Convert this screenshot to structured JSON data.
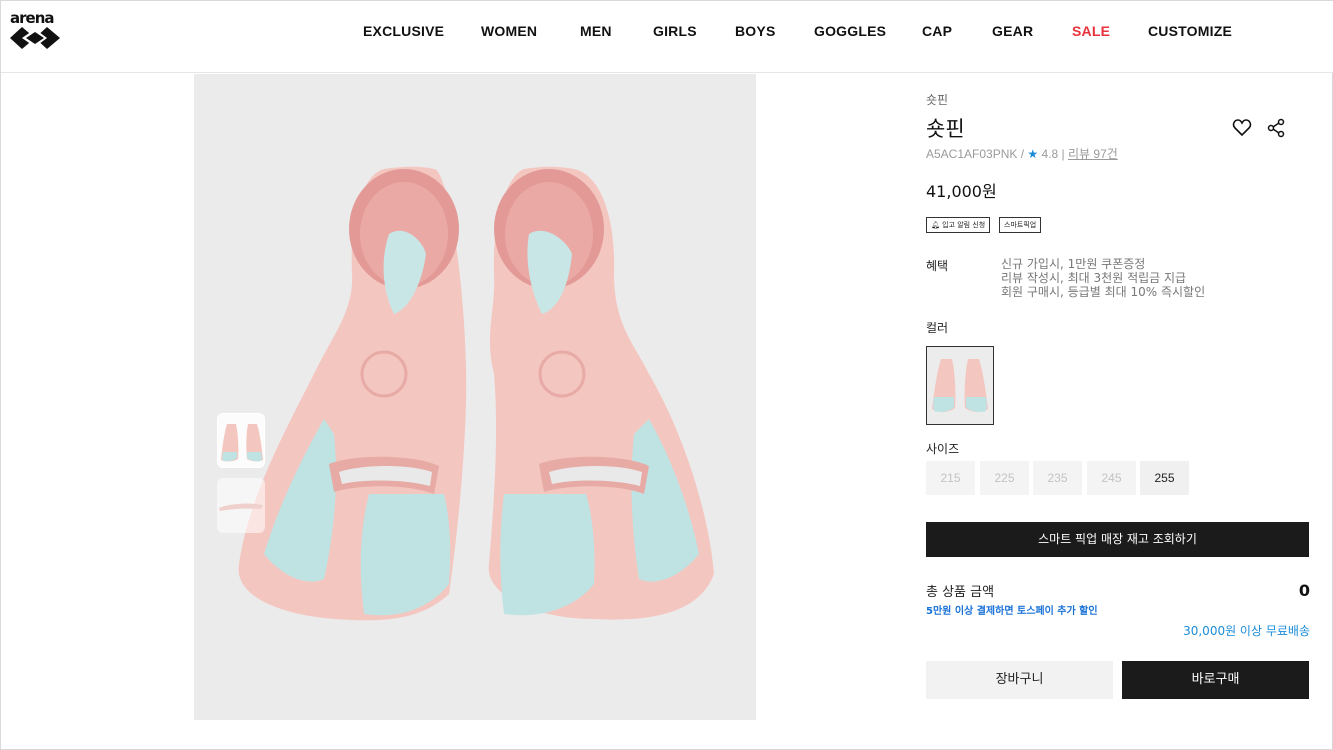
{
  "brand": {
    "logo_text": "arena"
  },
  "nav": {
    "items": [
      {
        "label": "EXCLUSIVE"
      },
      {
        "label": "WOMEN"
      },
      {
        "label": "MEN"
      },
      {
        "label": "GIRLS"
      },
      {
        "label": "BOYS"
      },
      {
        "label": "GOGGLES"
      },
      {
        "label": "CAP"
      },
      {
        "label": "GEAR"
      },
      {
        "label": "SALE"
      },
      {
        "label": "CUSTOMIZE"
      }
    ],
    "sale_color": "#e8323c"
  },
  "product": {
    "category": "숏핀",
    "name": "숏핀",
    "code": "A5AC1AF03PNK",
    "rating": "4.8",
    "review_label": "리뷰 97건",
    "price": "41,000원",
    "chips": [
      "입고 알림 신청",
      "스마트픽업"
    ],
    "benefit_label": "혜택",
    "benefits": [
      "신규 가입시, 1만원 쿠폰증정",
      "리뷰 작성시, 최대 3천원 적립금 지급",
      "회원 구매시, 등급별 최대 10% 즉시할인"
    ],
    "color_label": "컬러",
    "size_label": "사이즈",
    "sizes": [
      {
        "label": "215",
        "available": false
      },
      {
        "label": "225",
        "available": false
      },
      {
        "label": "235",
        "available": false
      },
      {
        "label": "245",
        "available": false
      },
      {
        "label": "255",
        "available": true
      }
    ],
    "pickup_button": "스마트 픽업 매장 재고 조회하기",
    "total_label": "총 상품 금액",
    "total_value": "0",
    "toss_promo": "5만원 이상 결제하면 토스페이 추가 할인",
    "free_shipping": "30,000원 이상 무료배송",
    "cart_button": "장바구니",
    "buy_button": "바로구매"
  },
  "colors": {
    "fin_pink": "#f2c2bd",
    "fin_aqua": "#bfe3e3",
    "accent_blue": "#1a8cd8",
    "button_dark": "#1b1b1b"
  },
  "icons": [
    "heart-icon",
    "share-icon",
    "star-icon"
  ]
}
